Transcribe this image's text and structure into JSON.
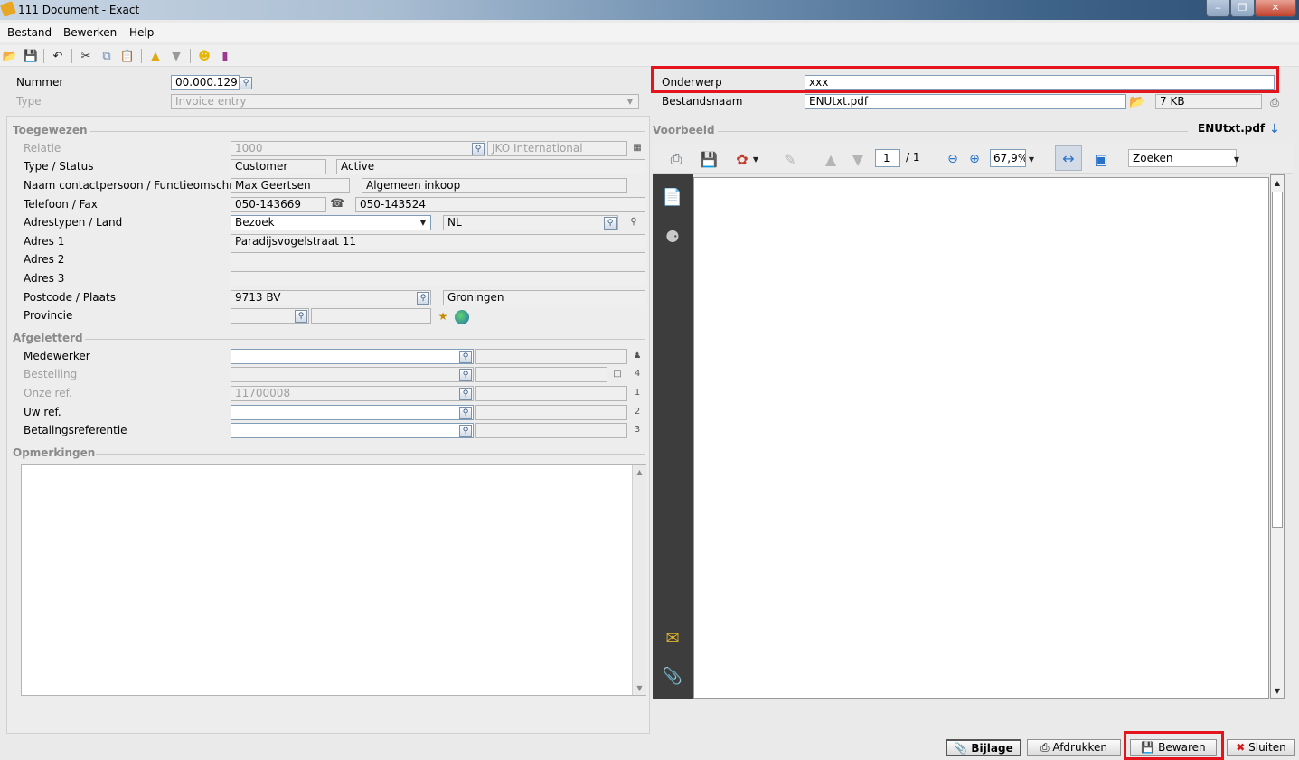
{
  "window": {
    "title": "111 Document - Exact",
    "min": "‒",
    "max": "❐",
    "close": "✕"
  },
  "menu": {
    "items": [
      "Bestand",
      "Bewerken",
      "Help"
    ]
  },
  "header": {
    "nummer_label": "Nummer",
    "nummer_value": "00.000.129",
    "type_label": "Type",
    "type_value": "Invoice entry",
    "onderwerp_label": "Onderwerp",
    "onderwerp_value": "xxx",
    "bestandsnaam_label": "Bestandsnaam",
    "bestandsnaam_value": "ENUtxt.pdf",
    "size_value": "7 KB"
  },
  "toegewezen": {
    "title": "Toegewezen",
    "relatie_label": "Relatie",
    "relatie_code": "1000",
    "relatie_name": "JKO International",
    "type_status_label": "Type / Status",
    "type_value": "Customer",
    "status_value": "Active",
    "contact_label": "Naam contactpersoon / Functieomschr.",
    "contact_value": "Max Geertsen",
    "functie_value": "Algemeen inkoop",
    "telefoon_label": "Telefoon / Fax",
    "telefoon_value": "050-143669",
    "fax_value": "050-143524",
    "adrestype_label": "Adrestypen / Land",
    "adrestype_value": "Bezoek",
    "land_value": "NL",
    "adres1_label": "Adres 1",
    "adres1_value": "Paradijsvogelstraat 11",
    "adres2_label": "Adres 2",
    "adres2_value": "",
    "adres3_label": "Adres 3",
    "adres3_value": "",
    "postcode_label": "Postcode / Plaats",
    "postcode_value": "9713 BV",
    "plaats_value": "Groningen",
    "provincie_label": "Provincie",
    "provincie_value": ""
  },
  "afgeletterd": {
    "title": "Afgeletterd",
    "medewerker_label": "Medewerker",
    "medewerker_value": "",
    "bestelling_label": "Bestelling",
    "bestelling_value": "",
    "onzeref_label": "Onze ref.",
    "onzeref_value": "11700008",
    "uwref_label": "Uw ref.",
    "uwref_value": "",
    "betaling_label": "Betalingsreferentie",
    "betaling_value": ""
  },
  "opmerkingen": {
    "title": "Opmerkingen",
    "value": ""
  },
  "voorbeeld": {
    "title": "Voorbeeld",
    "filename": "ENUtxt.pdf",
    "page_current": "1",
    "page_total": "/ 1",
    "zoom": "67,9%",
    "search_placeholder": "Zoeken"
  },
  "buttons": {
    "bijlage": "Bijlage",
    "afdrukken": "Afdrukken",
    "bewaren": "Bewaren",
    "sluiten": "Sluiten"
  },
  "colors": {
    "highlight": "#e3141c",
    "pdf_sidebar": "#3d3d3d"
  },
  "icons": {
    "open": "folder-open-icon",
    "save": "save-icon",
    "undo": "undo-icon",
    "cut": "scissors-icon",
    "copy": "copy-icon",
    "paste": "paste-icon",
    "up": "arrow-up-icon",
    "down": "arrow-down-icon"
  }
}
